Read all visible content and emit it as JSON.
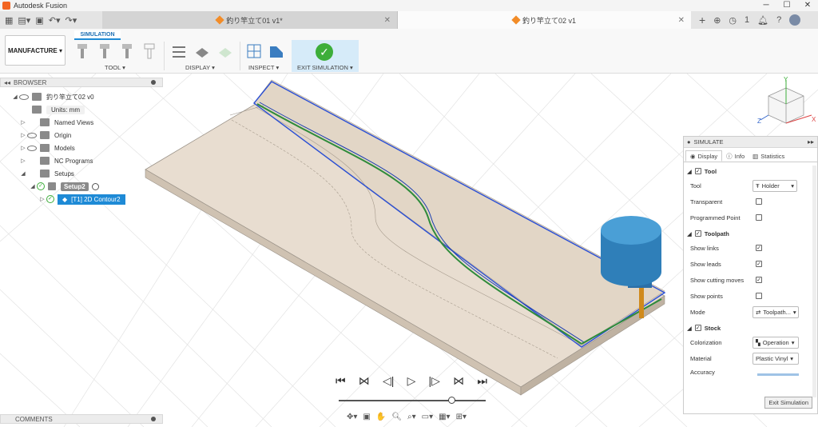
{
  "window": {
    "app_title": "Autodesk Fusion"
  },
  "tabs": [
    {
      "label": "釣り竿立て01 v1*",
      "active": false
    },
    {
      "label": "釣り竿立て02 v1",
      "active": true
    }
  ],
  "tab_bar": {
    "notification_count": "1"
  },
  "toolbar": {
    "workspace": "MANUFACTURE ▾",
    "active_tab": "SIMULATION",
    "groups": {
      "tool": "TOOL ▾",
      "display": "DISPLAY ▾",
      "inspect": "INSPECT ▾",
      "exit": "EXIT SIMULATION ▾"
    }
  },
  "browser": {
    "title": "BROWSER",
    "root": "釣り竿立て02 v0",
    "units": "Units: mm",
    "items": [
      "Named Views",
      "Origin",
      "Models",
      "NC Programs",
      "Setups"
    ],
    "setup": "Setup2",
    "operation": "[T1] 2D Contour2"
  },
  "comments": {
    "title": "COMMENTS"
  },
  "simulate": {
    "title": "SIMULATE",
    "tabs": [
      "Display",
      "Info",
      "Statistics"
    ],
    "sections": {
      "tool": "Tool",
      "toolpath": "Toolpath",
      "stock": "Stock"
    },
    "props": {
      "tool_label": "Tool",
      "tool_value": "Holder",
      "transparent": "Transparent",
      "programmed_point": "Programmed Point",
      "show_links": "Show links",
      "show_leads": "Show leads",
      "show_cutting": "Show cutting moves",
      "show_points": "Show points",
      "mode_label": "Mode",
      "mode_value": "Toolpath...",
      "colorization_label": "Colorization",
      "colorization_value": "Operation",
      "material_label": "Material",
      "material_value": "Plastic Vinyl",
      "accuracy_label": "Accuracy"
    },
    "exit_button": "Exit Simulation"
  },
  "viewcube": {
    "x": "X",
    "y": "Y",
    "z": "Z"
  },
  "colors": {
    "accent": "#1e8ad6",
    "stock": "#e8ddd0",
    "tool": "#2f7fb9",
    "toolpath": "#2a4fd6",
    "cut": "#2e8b3a"
  }
}
